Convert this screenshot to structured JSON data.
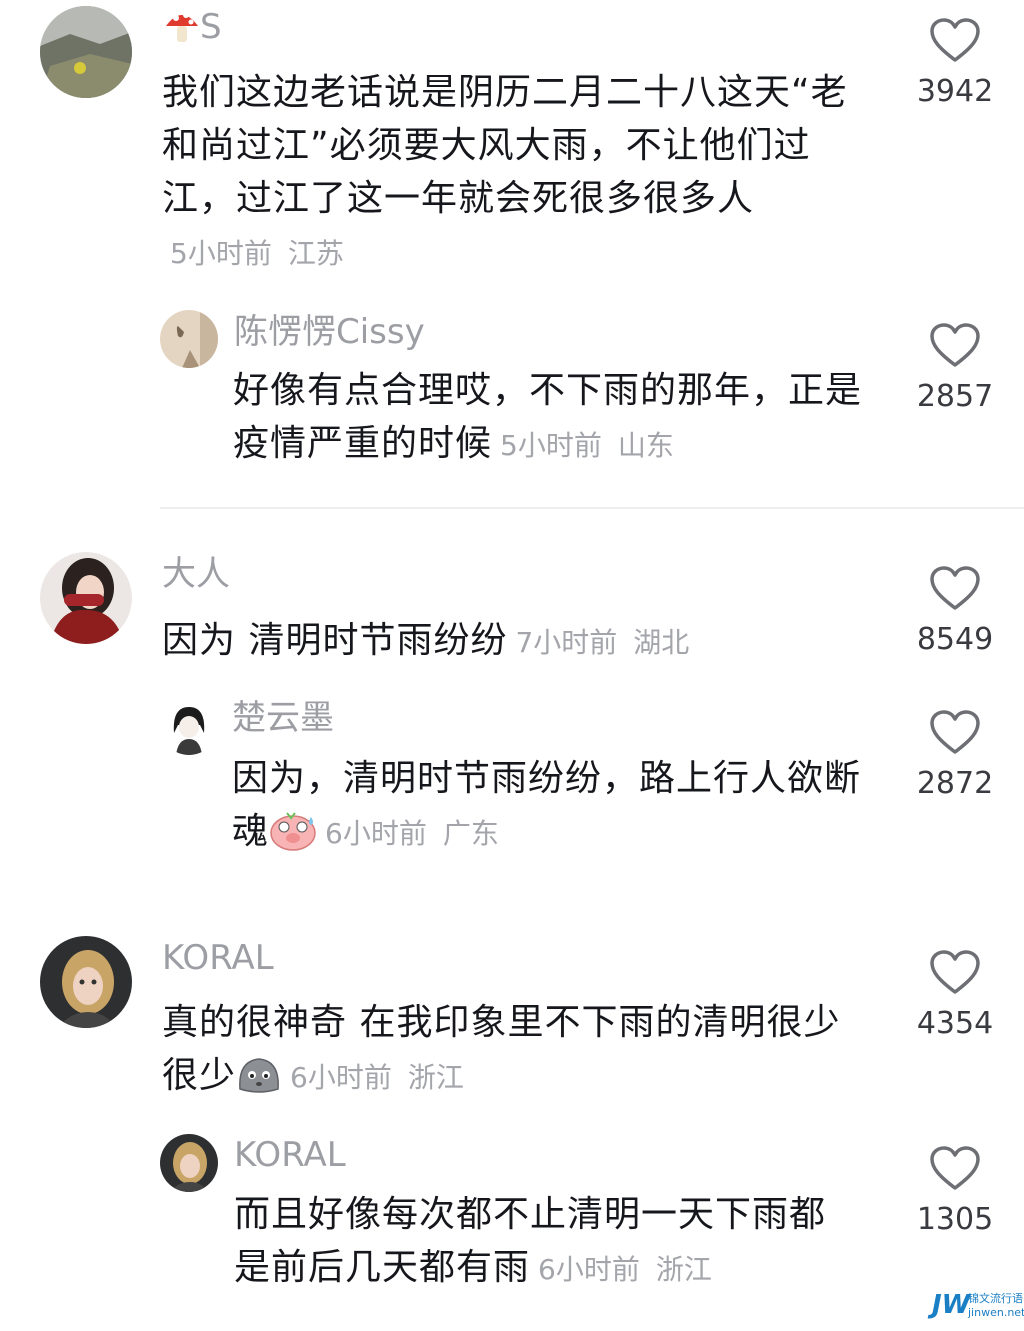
{
  "comments": [
    {
      "username": "S",
      "text": "我们这边老话说是阴历二月二十八这天“老和尚过江”必须要大风大雨，不让他们过江，过江了这一年就会死很多很多人",
      "time": "5小时前",
      "location": "江苏",
      "likes": "3942",
      "avatar_icon": "landscape-avatar-icon",
      "replies": [
        {
          "username": "陈愣愣Cissy",
          "text": "好像有点合理哎，不下雨的那年，正是疫情严重的时候",
          "time": "5小时前",
          "location": "山东",
          "likes": "2857",
          "avatar_icon": "butterfly-shadow-avatar-icon"
        }
      ]
    },
    {
      "username": "大人",
      "text": "因为 清明时节雨纷纷",
      "time": "7小时前",
      "location": "湖北",
      "likes": "8549",
      "avatar_icon": "woman-red-sweater-avatar-icon",
      "replies": [
        {
          "username": "楚云墨",
          "text": "因为，清明时节雨纷纷，路上行人欲断魂",
          "time": "6小时前",
          "location": "广东",
          "likes": "2872",
          "avatar_icon": "anime-girl-avatar-icon",
          "emoji": "pig-sweat-emoji"
        }
      ]
    },
    {
      "username": "KORAL",
      "text": "真的很神奇 在我印象里不下雨的清明很少很少",
      "time": "6小时前",
      "location": "浙江",
      "likes": "4354",
      "avatar_icon": "doll-avatar-icon",
      "emoji": "gray-blob-emoji",
      "replies": [
        {
          "username": "KORAL",
          "text": "而且好像每次都不止清明一天下雨都是前后几天都有雨",
          "time": "6小时前",
          "location": "浙江",
          "likes": "1305",
          "avatar_icon": "doll-avatar-icon"
        }
      ]
    }
  ],
  "watermark": {
    "logo": "JW",
    "line1": "锦文流行语",
    "line2": "jinwen.net"
  },
  "colors": {
    "username": "#9c9ea4",
    "meta": "#a3a5ab",
    "body": "#16171c",
    "heart_stroke": "#6e6f74"
  }
}
